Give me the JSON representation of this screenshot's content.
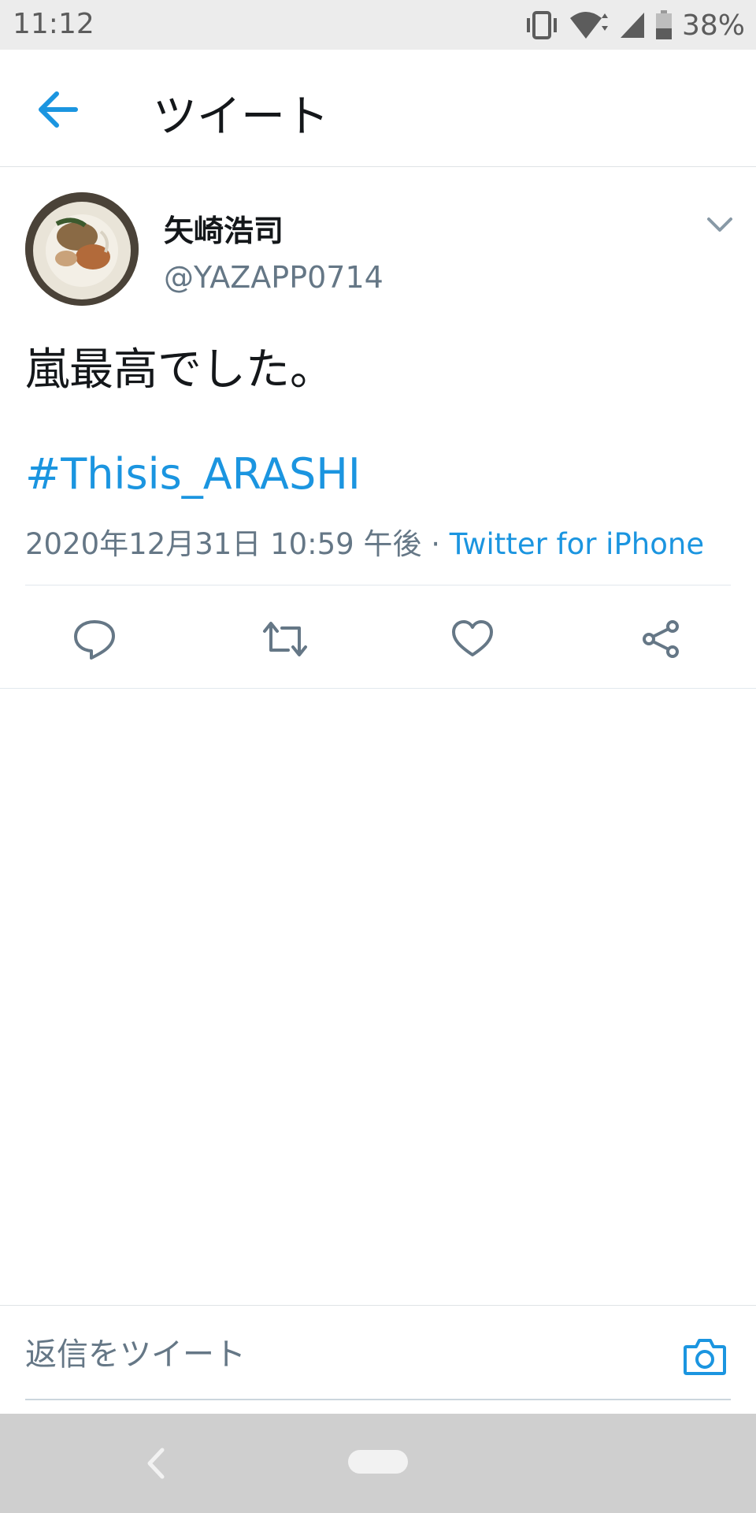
{
  "status_bar": {
    "time": "11:12",
    "battery_percent": "38%"
  },
  "header": {
    "title": "ツイート"
  },
  "tweet": {
    "display_name": "矢崎浩司",
    "handle": "@YAZAPP0714",
    "text": "嵐最高でした。",
    "hashtag": "#Thisis_ARASHI",
    "timestamp": "2020年12月31日 10:59 午後",
    "separator": " · ",
    "source": "Twitter for iPhone"
  },
  "reply": {
    "placeholder": "返信をツイート"
  },
  "colors": {
    "accent": "#1b95e0",
    "secondary_text": "#657786",
    "primary_text": "#14171a",
    "divider": "#e1e8ed"
  },
  "icons": {
    "back": "arrow-left-icon",
    "caret": "chevron-down-icon",
    "reply": "speech-bubble-icon",
    "retweet": "retweet-icon",
    "like": "heart-icon",
    "share": "share-icon",
    "camera": "camera-icon"
  }
}
